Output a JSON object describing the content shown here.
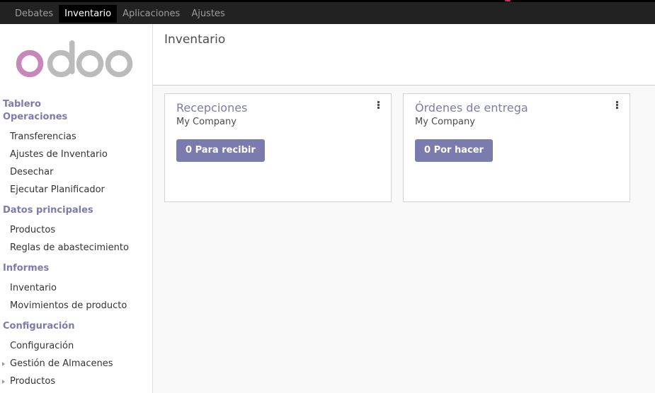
{
  "topbar": {
    "menu": [
      {
        "label": "Debates",
        "active": false
      },
      {
        "label": "Inventario",
        "active": true
      },
      {
        "label": "Aplicaciones",
        "active": false
      },
      {
        "label": "Ajustes",
        "active": false
      }
    ]
  },
  "sidebar": {
    "logo": {
      "text": "odoo",
      "color_o": "#c688b8",
      "color_doo": "#bbbbbb"
    },
    "sections": [
      {
        "label": "Tablero",
        "items": []
      },
      {
        "label": "Operaciones",
        "items": [
          {
            "label": "Transferencias",
            "expandable": false
          },
          {
            "label": "Ajustes de Inventario",
            "expandable": false
          },
          {
            "label": "Desechar",
            "expandable": false
          },
          {
            "label": "Ejecutar Planificador",
            "expandable": false
          }
        ]
      },
      {
        "label": "Datos principales",
        "items": [
          {
            "label": "Productos",
            "expandable": false
          },
          {
            "label": "Reglas de abastecimiento",
            "expandable": false
          }
        ]
      },
      {
        "label": "Informes",
        "items": [
          {
            "label": "Inventario",
            "expandable": false
          },
          {
            "label": "Movimientos de producto",
            "expandable": false
          }
        ]
      },
      {
        "label": "Configuración",
        "items": [
          {
            "label": "Configuración",
            "expandable": false
          },
          {
            "label": "Gestión de Almacenes",
            "expandable": true
          },
          {
            "label": "Productos",
            "expandable": true
          }
        ]
      }
    ]
  },
  "main": {
    "breadcrumb": "Inventario",
    "cards": [
      {
        "title": "Recepciones",
        "company": "My Company",
        "button": "0 Para recibir",
        "icon": "kebab-icon"
      },
      {
        "title": "Órdenes de entrega",
        "company": "My Company",
        "button": "0 Por hacer",
        "icon": "kebab-icon"
      }
    ]
  },
  "colors": {
    "accent": "#7c7bad",
    "topbar": "#222222",
    "active_tab": "#000000"
  }
}
